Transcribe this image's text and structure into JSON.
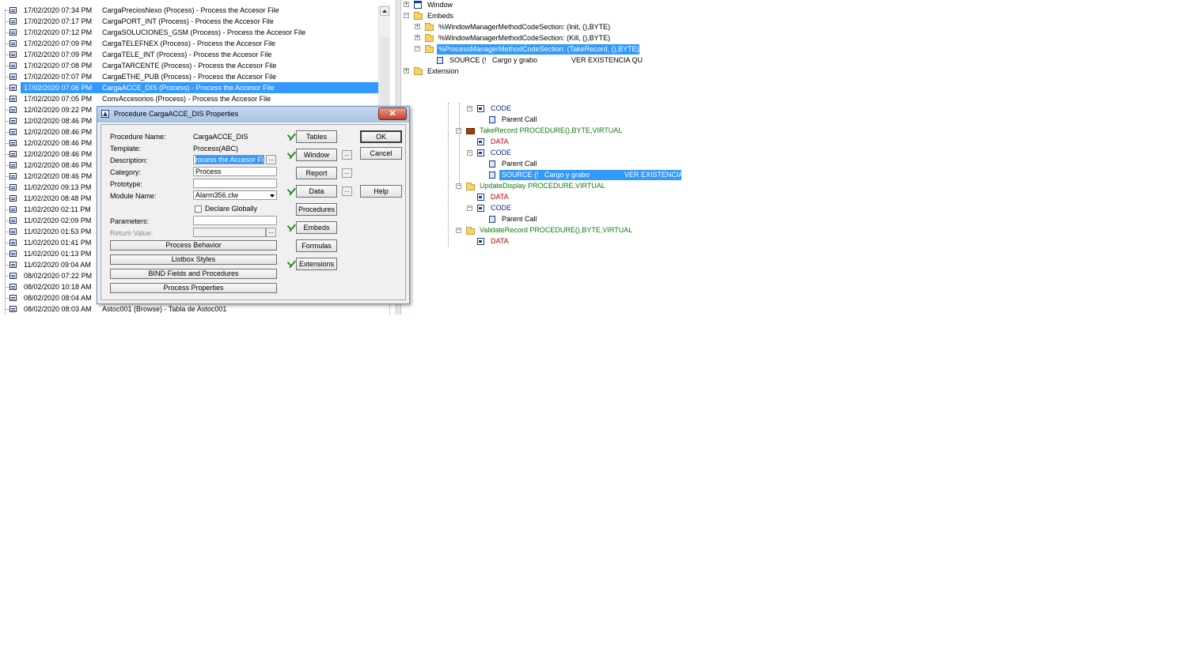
{
  "left_list": {
    "rows": [
      {
        "date": "17/02/2020 07:34 PM",
        "desc": "CargaPreciosNexo (Process) - Process the Accesor File"
      },
      {
        "date": "17/02/2020 07:17 PM",
        "desc": "CargaPORT_INT (Process) - Process the Accesor File"
      },
      {
        "date": "17/02/2020 07:12 PM",
        "desc": "CargaSOLUCIONES_GSM (Process) - Process the Accesor File"
      },
      {
        "date": "17/02/2020 07:09 PM",
        "desc": "CargaTELEFNEX (Process) - Process the Accesor File"
      },
      {
        "date": "17/02/2020 07:09 PM",
        "desc": "CargaTELE_INT (Process) - Process the Accesor File"
      },
      {
        "date": "17/02/2020 07:08 PM",
        "desc": "CargaTARCENTE (Process) - Process the Accesor File"
      },
      {
        "date": "17/02/2020 07:07 PM",
        "desc": "CargaETHE_PUB (Process) - Process the Accesor File"
      },
      {
        "date": "17/02/2020 07:06 PM",
        "desc": "CargaACCE_DIS (Process) - Process the Accesor File",
        "selected": true
      },
      {
        "date": "17/02/2020 07:05 PM",
        "desc": "ConvAccesorios (Process) - Process the Accesor File"
      },
      {
        "date": "12/02/2020 09:22 PM",
        "desc": ""
      },
      {
        "date": "12/02/2020 08:46 PM",
        "desc": ""
      },
      {
        "date": "12/02/2020 08:46 PM",
        "desc": ""
      },
      {
        "date": "12/02/2020 08:46 PM",
        "desc": ""
      },
      {
        "date": "12/02/2020 08:46 PM",
        "desc": ""
      },
      {
        "date": "12/02/2020 08:46 PM",
        "desc": ""
      },
      {
        "date": "12/02/2020 08:46 PM",
        "desc": ""
      },
      {
        "date": "11/02/2020 09:13 PM",
        "desc": ""
      },
      {
        "date": "11/02/2020 08:48 PM",
        "desc": ""
      },
      {
        "date": "11/02/2020 02:11 PM",
        "desc": ""
      },
      {
        "date": "11/02/2020 02:09 PM",
        "desc": ""
      },
      {
        "date": "11/02/2020 01:53 PM",
        "desc": ""
      },
      {
        "date": "11/02/2020 01:41 PM",
        "desc": ""
      },
      {
        "date": "11/02/2020 01:13 PM",
        "desc": ""
      },
      {
        "date": "11/02/2020 09:04 AM",
        "desc": ""
      },
      {
        "date": "08/02/2020 07:22 PM",
        "desc": ""
      },
      {
        "date": "08/02/2020 10:18 AM",
        "desc": ""
      },
      {
        "date": "08/02/2020 08:04 AM",
        "desc": ""
      },
      {
        "date": "08/02/2020 08:03 AM",
        "desc": "Astoc001 (Browse) - Tabla de Astoc001"
      }
    ]
  },
  "tree_top": {
    "window": "Window",
    "embeds": "Embeds",
    "init": "%WindowManagerMethodCodeSection:  (Init, (),BYTE)",
    "kill": "%WindowManagerMethodCodeSection:  (Kill, (),BYTE)",
    "takerecord": "%ProcessManagerMethodCodeSection:  (TakeRecord, (),BYTE)",
    "source_a": "SOURCE (!",
    "source_b": "Cargo y grabo",
    "source_c": "VER EXISTENCIA QU",
    "extension": "Extension"
  },
  "tree_bottom": {
    "code1": "CODE",
    "parent1": "Parent Call",
    "takerecord": "TakeRecord PROCEDURE(),BYTE,VIRTUAL",
    "data1": "DATA",
    "code2": "CODE",
    "parent2": "Parent Call",
    "source_a": "SOURCE (!",
    "source_b": "Cargo y grabo",
    "source_c": "VER EXISTENCIA",
    "updatedisplay": "UpdateDisplay PROCEDURE,VIRTUAL",
    "data2": "DATA",
    "code3": "CODE",
    "parent3": "Parent Call",
    "validaterecord": "ValidateRecord PROCEDURE(),BYTE,VIRTUAL",
    "data3": "DATA"
  },
  "dialog": {
    "title": "Procedure CargaACCE_DIS Properties",
    "close": "✕",
    "procedure_name_label": "Procedure Name:",
    "procedure_name": "CargaACCE_DIS",
    "template_label": "Template:",
    "template": "Process(ABC)",
    "description_label": "Description:",
    "description": "rocess the Accesor File",
    "category_label": "Category:",
    "category": "Process",
    "prototype_label": "Prototype:",
    "prototype": "",
    "module_label": "Module Name:",
    "module": "Alarm356.clw",
    "declare_globally": "Declare Globally",
    "parameters_label": "Parameters:",
    "parameters": "",
    "return_label": "Return Value:",
    "return_value": "",
    "ellipsis": "...",
    "btn_process_behavior": "Process Behavior",
    "btn_listbox_styles": "Listbox Styles",
    "btn_bind": "BIND Fields and Procedures",
    "btn_process_properties": "Process Properties",
    "btn_tables": "Tables",
    "btn_window": "Window",
    "btn_report": "Report",
    "btn_data": "Data",
    "btn_procedures": "Procedures",
    "btn_embeds": "Embeds",
    "btn_formulas": "Formulas",
    "btn_extensions": "Extensions",
    "btn_ok": "OK",
    "btn_cancel": "Cancel",
    "btn_help": "Help"
  }
}
